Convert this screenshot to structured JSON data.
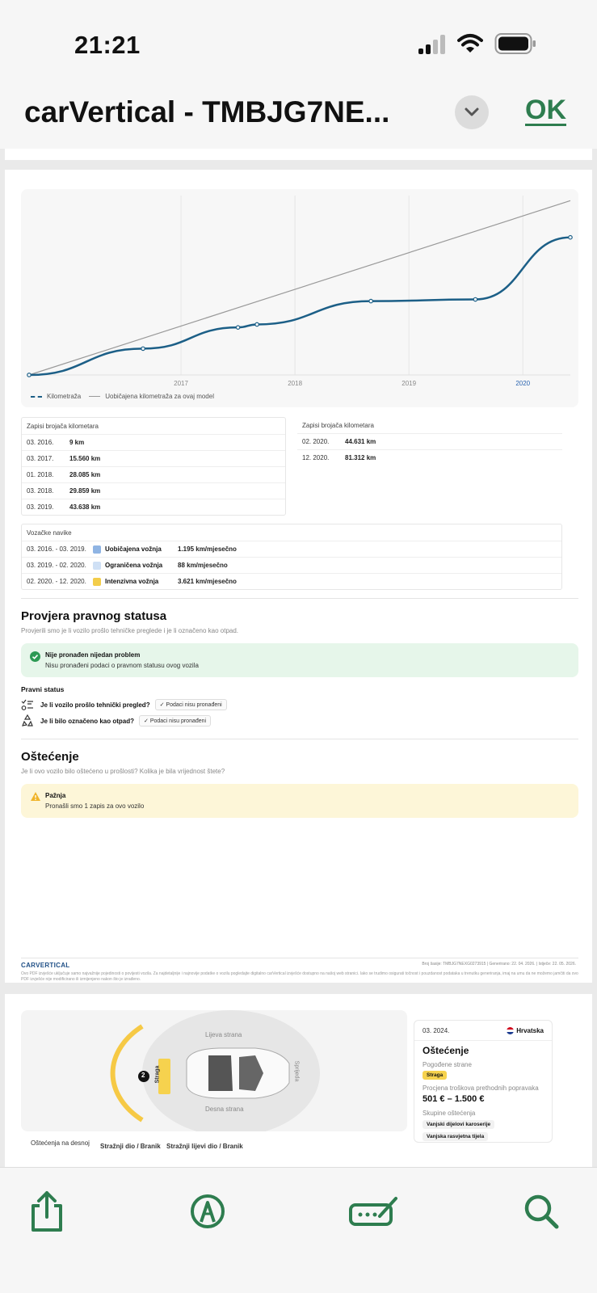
{
  "status_bar": {
    "time": "21:21"
  },
  "header": {
    "title": "carVertical - TMBJG7NE...",
    "ok_label": "OK"
  },
  "colors": {
    "accent": "#2e7d4f",
    "mileage_line": "#1c5f87",
    "success_bg": "#e6f6ea",
    "warning_bg": "#fdf6d8"
  },
  "chart_data": {
    "type": "line",
    "x_ticks": [
      "2017",
      "2018",
      "2019",
      "2020"
    ],
    "series": [
      {
        "name": "Kilometraža",
        "points": [
          [
            "03. 2016.",
            9
          ],
          [
            "03. 2017.",
            15560
          ],
          [
            "01. 2018.",
            28085
          ],
          [
            "03. 2018.",
            29859
          ],
          [
            "03. 2019.",
            43638
          ],
          [
            "02. 2020.",
            44631
          ],
          [
            "12. 2020.",
            81312
          ]
        ]
      },
      {
        "name": "Uobičajena kilometraža za ovaj model",
        "points": [
          [
            "03. 2016.",
            0
          ],
          [
            "12. 2020.",
            103000
          ]
        ]
      }
    ],
    "grid": true,
    "legend": "bottom-left"
  },
  "odometer": {
    "header_left": "Zapisi brojača kilometara",
    "header_right": "Zapisi brojača kilometara",
    "left_rows": [
      {
        "date": "03. 2016.",
        "value": "9 km"
      },
      {
        "date": "03. 2017.",
        "value": "15.560 km"
      },
      {
        "date": "01. 2018.",
        "value": "28.085 km"
      },
      {
        "date": "03. 2018.",
        "value": "29.859 km"
      },
      {
        "date": "03. 2019.",
        "value": "43.638 km"
      }
    ],
    "right_rows": [
      {
        "date": "02. 2020.",
        "value": "44.631 km"
      },
      {
        "date": "12. 2020.",
        "value": "81.312 km"
      }
    ]
  },
  "habits": {
    "header": "Vozačke navike",
    "rows": [
      {
        "period": "03. 2016. - 03. 2019.",
        "color": "#8fb4e3",
        "label": "Uobičajena vožnja",
        "value": "1.195 km/mjesečno"
      },
      {
        "period": "03. 2019. - 02. 2020.",
        "color": "#cfe0f5",
        "label": "Ograničena vožnja",
        "value": "88 km/mjesečno"
      },
      {
        "period": "02. 2020. - 12. 2020.",
        "color": "#f3cd4a",
        "label": "Intenzivna vožnja",
        "value": "3.621 km/mjesečno"
      }
    ]
  },
  "legal": {
    "title": "Provjera pravnog statusa",
    "subtitle": "Provjerili smo je li vozilo prošlo tehničke preglede i je li označeno kao otpad.",
    "alert_title": "Nije pronađen nijedan problem",
    "alert_text": "Nisu pronađeni podaci o pravnom statusu ovog vozila",
    "status_label": "Pravni status",
    "q1": "Je li vozilo prošlo tehnički pregled?",
    "q2": "Je li bilo označeno kao otpad?",
    "chip": "Podaci nisu pronađeni"
  },
  "damage": {
    "title": "Oštećenje",
    "subtitle": "Je li ovo vozilo bilo oštećeno u prošlosti? Kolika je bila vrijednost štete?",
    "alert_title": "Pažnja",
    "alert_text": "Pronašli smo 1 zapis za ovo vozilo"
  },
  "footer": {
    "logo": "CARVERTICAL",
    "meta": "Broj šasije: TMBJG7NEXG0273915   |   Generirano: 22. 04. 2026.   |   Istječe: 22. 05. 2026.",
    "note": "Ovo PDF izvješće uključuje samo najvažnije pojedinosti o povijesti vozila. Za najdetaljnije i najnovije podatke o vozilu pogledajte digitalno carVertical izvješće dostupno na našoj web stranici. Iako se trudimo osigurati točnost i pouzdanost podataka u trenutku generiranja, imaj na umu da ne možemo jamčiti da ovo PDF izvješće nije modificirano ili izmijenjeno nakon što je izrađeno."
  },
  "damage_diagram": {
    "left_side": "Lijeva strana",
    "right_side": "Desna strana",
    "front": "Sprijeda",
    "rear": "Straga",
    "badge": "2",
    "label_1": "Oštećenja na desnoj",
    "label_2": "Stražnji dio / Branik",
    "label_3": "Stražnji lijevi dio / Branik"
  },
  "damage_card": {
    "date": "03. 2024.",
    "country": "Hrvatska",
    "title": "Oštećenje",
    "sides_label": "Pogođene strane",
    "side_chip": "Straga",
    "cost_label": "Procjena troškova prethodnih popravaka",
    "cost": "501 € – 1.500 €",
    "groups_label": "Skupine oštećenja",
    "group_1": "Vanjski dijelovi karoserije",
    "group_2": "Vanjska rasvjetna tijela"
  }
}
